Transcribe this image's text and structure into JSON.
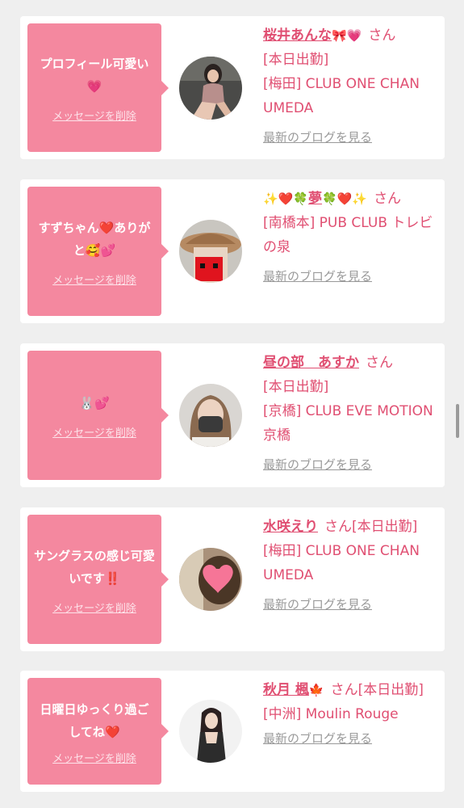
{
  "delete_label": "メッセージを削除",
  "blog_label": "最新のブログを見る",
  "cards": [
    {
      "message": "プロフィール可愛い",
      "message_emoji": "💗",
      "name": "桜井あんな",
      "name_emoji": "🎀💗",
      "san": "さん",
      "status": "[本日出勤]",
      "shop": "[梅田] CLUB ONE CHAN UMEDA"
    },
    {
      "message": "すずちゃん",
      "message_emoji_1": "❤️",
      "message_2": "ありがと",
      "message_emoji_2": "🥰💕",
      "name_prefix_emoji": "✨❤️🍀",
      "name": "夢",
      "name_emoji": "🍀❤️✨",
      "san": "さん",
      "status": "",
      "shop": "[南橋本] PUB CLUB トレビの泉"
    },
    {
      "message_emoji": "🐰💕",
      "name": "昼の部　あすか",
      "san": "さん",
      "status": "[本日出勤]",
      "shop": "[京橋] CLUB EVE MOTION 京橋"
    },
    {
      "message": "サングラスの感じ可愛いです",
      "message_emoji": "‼️",
      "name": "水咲えり",
      "san": "さん",
      "status": "[本日出勤]",
      "shop": "[梅田] CLUB ONE CHAN UMEDA"
    },
    {
      "message": "日曜日ゆっくり過ごしてね",
      "message_emoji": "❤️",
      "name": "秋月 楓",
      "name_emoji": "🍁",
      "san": "さん",
      "status": "[本日出勤]",
      "shop": "[中洲] Moulin Rouge"
    }
  ]
}
